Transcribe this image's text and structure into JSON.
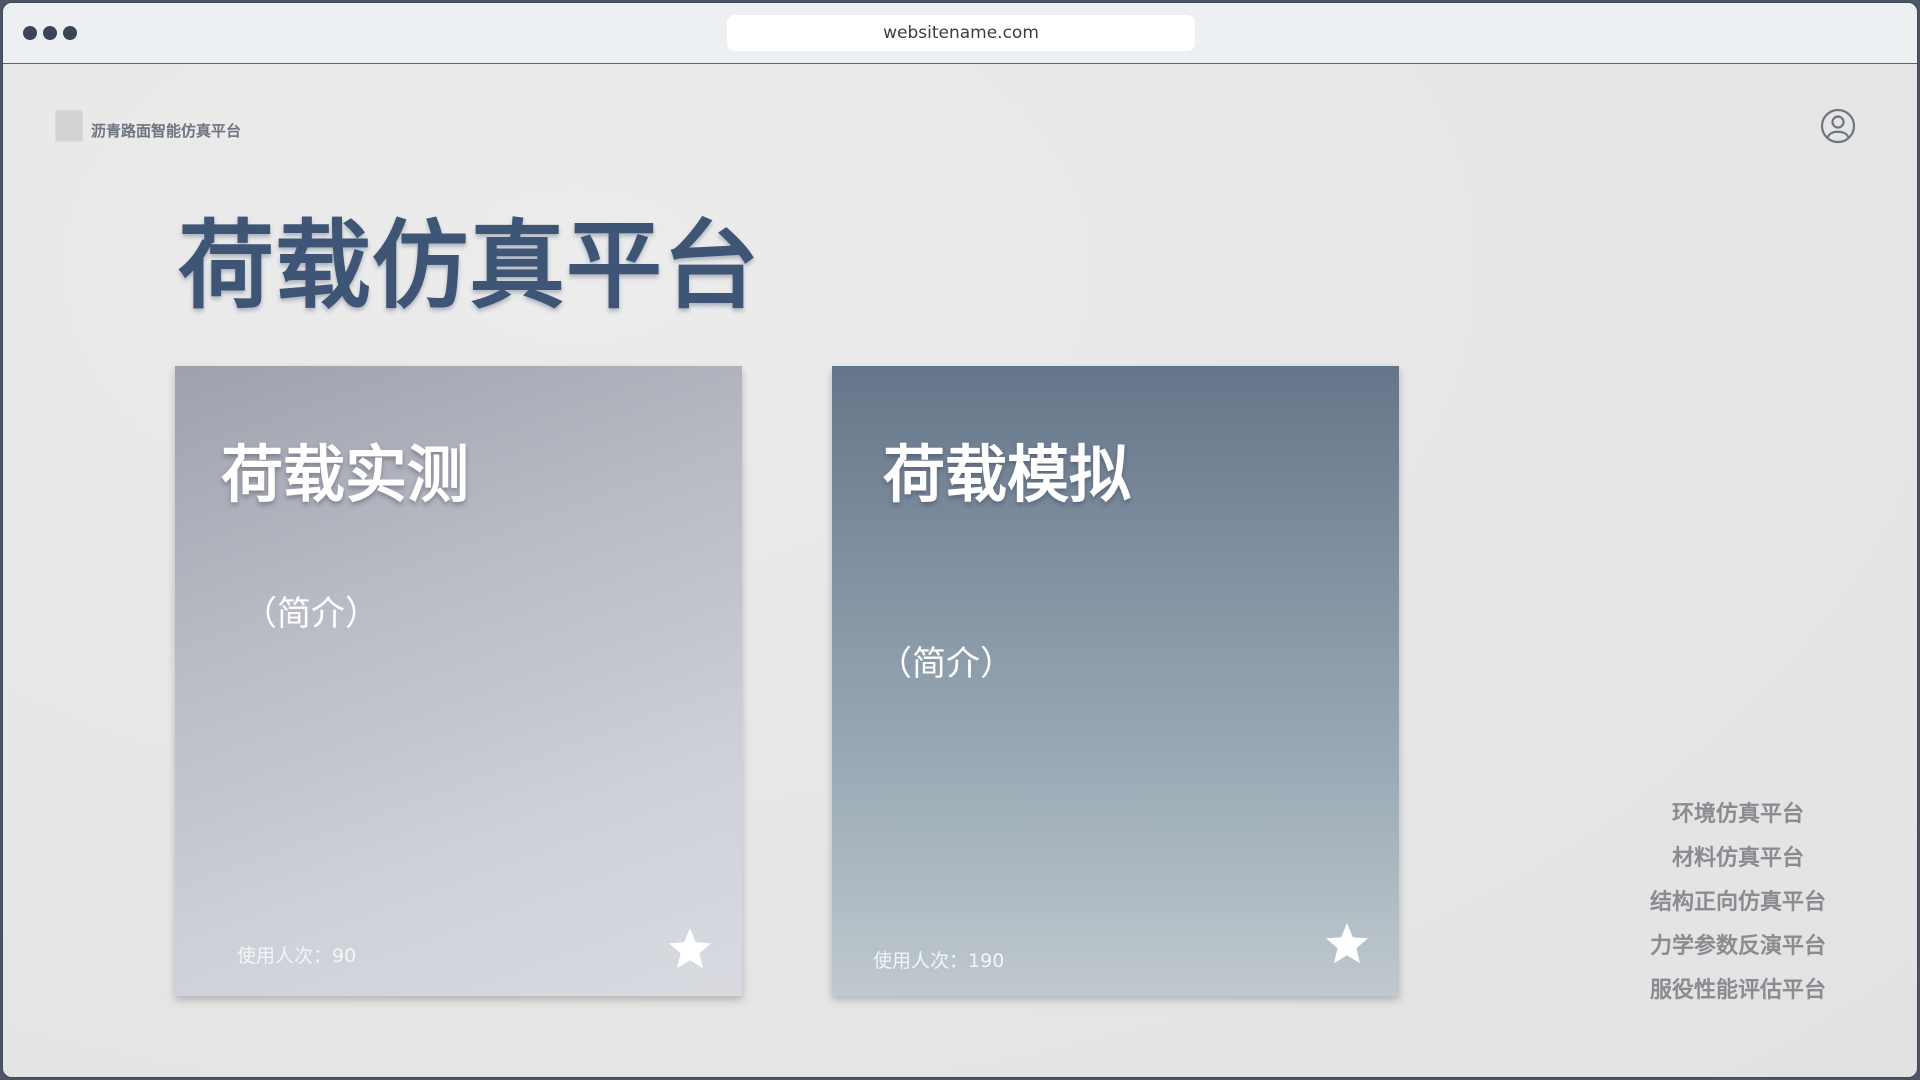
{
  "browser": {
    "url": "websitename.com"
  },
  "header": {
    "brand_name": "沥青路面智能仿真平台",
    "logo_icon": "logo-placeholder-icon",
    "user_icon": "user-circle-icon"
  },
  "main": {
    "title": "荷载仿真平台",
    "cards": [
      {
        "title": "荷载实测",
        "intro": "（简介）",
        "usage_label": "使用人次：",
        "usage_count": "90",
        "icon": "star-icon"
      },
      {
        "title": "荷载模拟",
        "intro": "（简介）",
        "usage_label": "使用人次：",
        "usage_count": "190",
        "icon": "star-icon"
      }
    ]
  },
  "side_nav": {
    "items": [
      "环境仿真平台",
      "材料仿真平台",
      "结构正向仿真平台",
      "力学参数反演平台",
      "服役性能评估平台"
    ]
  },
  "colors": {
    "title": "#3e5576",
    "side_link": "#8a8c91",
    "window_chrome": "#3a4556"
  }
}
